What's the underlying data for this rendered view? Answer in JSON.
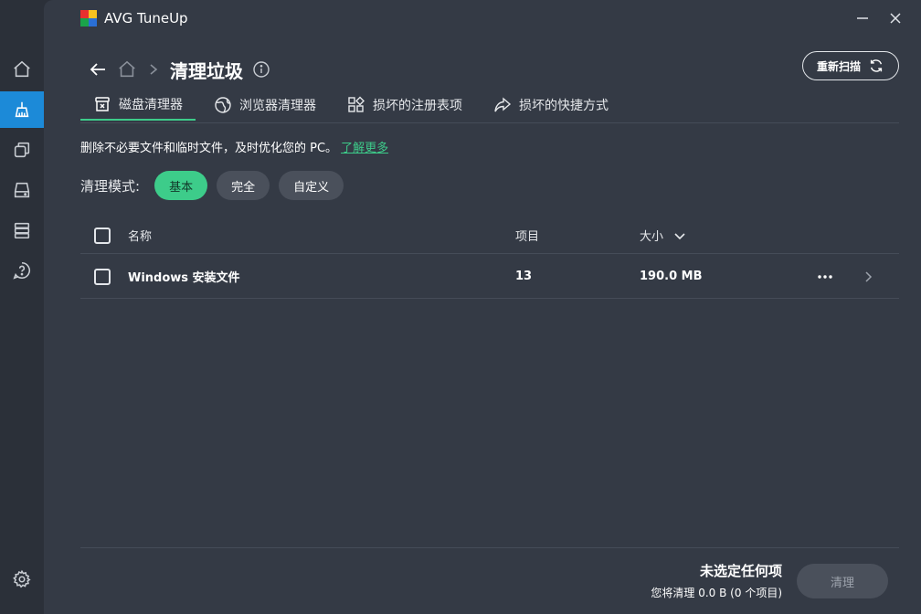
{
  "app": {
    "title": "AVG TuneUp"
  },
  "colors": {
    "accent": "#3dcc8a",
    "nav_active": "#1c8ad8",
    "panel": "#343a45",
    "sidebar": "#2b3039"
  },
  "sidebar": {
    "items": [
      {
        "icon": "home-icon",
        "active": false
      },
      {
        "icon": "broom-icon",
        "active": true
      },
      {
        "icon": "layers-icon",
        "active": false
      },
      {
        "icon": "drive-icon",
        "active": false
      },
      {
        "icon": "server-icon",
        "active": false
      },
      {
        "icon": "help-icon",
        "active": false
      },
      {
        "icon": "gear-icon",
        "active": false
      }
    ]
  },
  "header": {
    "page_title": "清理垃圾",
    "rescan_label": "重新扫描"
  },
  "tabs": [
    {
      "label": "磁盘清理器",
      "icon": "disk-clean-icon",
      "active": true
    },
    {
      "label": "浏览器清理器",
      "icon": "globe-icon",
      "active": false
    },
    {
      "label": "损坏的注册表项",
      "icon": "registry-icon",
      "active": false
    },
    {
      "label": "损坏的快捷方式",
      "icon": "shortcut-icon",
      "active": false
    }
  ],
  "description": {
    "text": "删除不必要文件和临时文件，及时优化您的 PC。",
    "link": "了解更多"
  },
  "mode": {
    "label": "清理模式:",
    "options": [
      "基本",
      "完全",
      "自定义"
    ],
    "selected": "基本"
  },
  "table": {
    "columns": {
      "name": "名称",
      "items": "项目",
      "size": "大小"
    },
    "rows": [
      {
        "name": "Windows 安装文件",
        "items": "13",
        "size": "190.0 MB",
        "checked": false
      }
    ]
  },
  "footer": {
    "status_main": "未选定任何项",
    "status_sub": "您将清理 0.0 B (0 个项目)",
    "clean_label": "清理"
  }
}
